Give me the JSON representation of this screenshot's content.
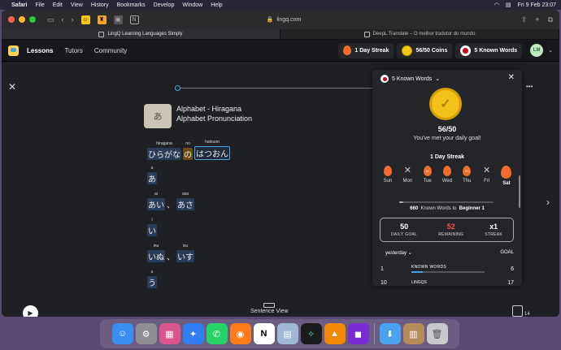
{
  "menubar": {
    "app": "Safari",
    "items": [
      "File",
      "Edit",
      "View",
      "History",
      "Bookmarks",
      "Develop",
      "Window",
      "Help"
    ],
    "clock": "Fri 9 Feb  23:07"
  },
  "browser": {
    "address": "lingq.com",
    "tabs": [
      {
        "label": "LingQ Learning Languages Simply"
      },
      {
        "label": "DeepL Translate – O melhor tradutor do mundo"
      }
    ]
  },
  "header": {
    "nav": [
      "Lessons",
      "Tutors",
      "Community"
    ],
    "streak": "1 Day Streak",
    "coins": "56/50 Coins",
    "known_words": "5 Known Words",
    "avatar": "LM"
  },
  "lesson": {
    "title": "Alphabet - Hiragana",
    "subtitle": "Alphabet Pronunciation",
    "img_text": "あ",
    "line1": {
      "w1_ruby": "hiragana",
      "w1": "ひらがな",
      "w2_ruby": "no",
      "w2": "の",
      "w3_ruby": "hatsuon",
      "w3": "はつおん"
    },
    "line2": {
      "ruby": "a",
      "word": "あ"
    },
    "line3": {
      "w1_ruby": "ai",
      "w1": "あい",
      "sep": "、",
      "w2_ruby": "asa",
      "w2": "あさ"
    },
    "line4": {
      "ruby": "i",
      "word": "い"
    },
    "line5": {
      "w1_ruby": "inu",
      "w1": "いぬ",
      "sep": "、",
      "w2_ruby": "isu",
      "w2": "いす"
    },
    "line6": {
      "ruby": "u",
      "word": "う"
    },
    "sentence_view": "Sentence View",
    "cards_count": "14"
  },
  "panel": {
    "known_words_label": "5  Known Words",
    "coins": "56/50",
    "goal_met": "You've met your daily goal!",
    "streak_title": "1 Day Streak",
    "days": [
      {
        "label": "Sun",
        "state": "flame",
        "mark": ""
      },
      {
        "label": "Mon",
        "state": "x",
        "mark": "✕"
      },
      {
        "label": "Tue",
        "state": "flame",
        "mark": "3X"
      },
      {
        "label": "Wed",
        "state": "flame",
        "mark": ""
      },
      {
        "label": "Thu",
        "state": "flame",
        "mark": "2X"
      },
      {
        "label": "Fri",
        "state": "x",
        "mark": "✕"
      },
      {
        "label": "Sat",
        "state": "flame",
        "mark": ""
      }
    ],
    "to_level_count": "660",
    "to_level_text": "Known Words to",
    "to_level_target": "Beginner 1",
    "stats": [
      {
        "value": "50",
        "label": "DAILY GOAL"
      },
      {
        "value": "52",
        "label": "REMAINING"
      },
      {
        "value": "x1",
        "label": "STREAK"
      }
    ],
    "period": "yesterday",
    "goal_col": "GOAL",
    "row1": {
      "rank": "1",
      "label": "KNOWN WORDS",
      "value": "6",
      "progress": 0.15
    },
    "row2": {
      "rank": "10",
      "label": "LINGQS",
      "value": "17"
    }
  },
  "colors": {
    "accent_blue": "#4aa3df",
    "flame": "#f26b2a",
    "coin": "#f3c11a",
    "remaining": "#ff4d4d"
  }
}
